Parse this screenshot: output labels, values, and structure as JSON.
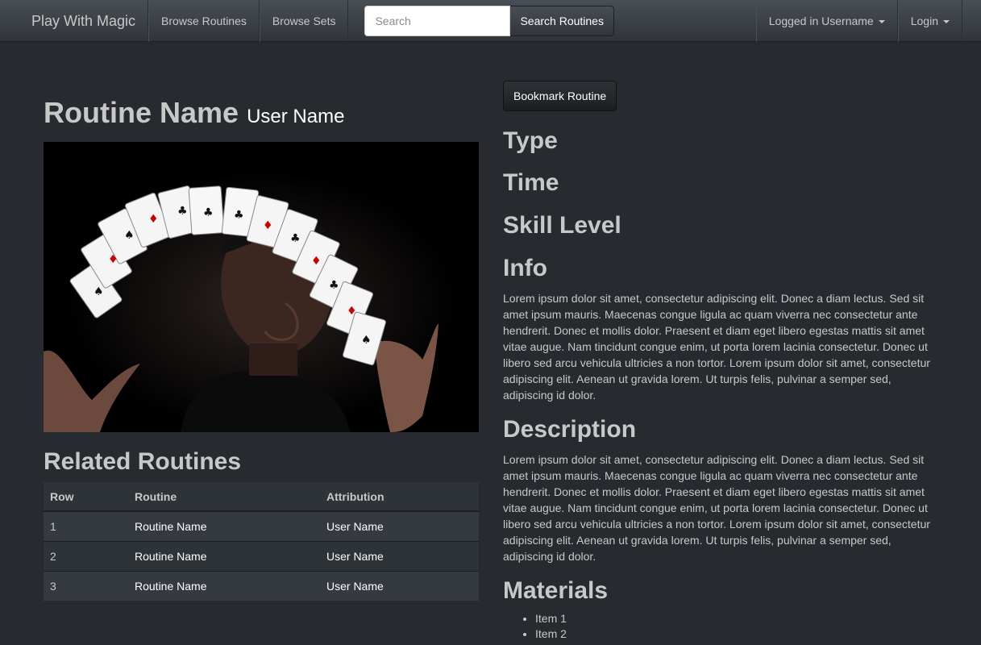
{
  "navbar": {
    "brand": "Play With Magic",
    "links": [
      "Browse Routines",
      "Browse Sets"
    ],
    "search_placeholder": "Search",
    "search_button": "Search Routines",
    "user_menu": "Logged in Username",
    "login_menu": "Login"
  },
  "routine": {
    "name": "Routine Name",
    "author": "User Name",
    "bookmark_label": "Bookmark Routine"
  },
  "related": {
    "title": "Related Routines",
    "headers": [
      "Row",
      "Routine",
      "Attribution"
    ],
    "rows": [
      [
        "1",
        "Routine Name",
        "User Name"
      ],
      [
        "2",
        "Routine Name",
        "User Name"
      ],
      [
        "3",
        "Routine Name",
        "User Name"
      ]
    ]
  },
  "details": {
    "type_heading": "Type",
    "time_heading": "Time",
    "skill_heading": "Skill Level",
    "info_heading": "Info",
    "info_text": "Lorem ipsum dolor sit amet, consectetur adipiscing elit. Donec a diam lectus. Sed sit amet ipsum mauris. Maecenas congue ligula ac quam viverra nec consectetur ante hendrerit. Donec et mollis dolor. Praesent et diam eget libero egestas mattis sit amet vitae augue. Nam tincidunt congue enim, ut porta lorem lacinia consectetur. Donec ut libero sed arcu vehicula ultricies a non tortor. Lorem ipsum dolor sit amet, consectetur adipiscing elit. Aenean ut gravida lorem. Ut turpis felis, pulvinar a semper sed, adipiscing id dolor.",
    "description_heading": "Description",
    "description_text": "Lorem ipsum dolor sit amet, consectetur adipiscing elit. Donec a diam lectus. Sed sit amet ipsum mauris. Maecenas congue ligula ac quam viverra nec consectetur ante hendrerit. Donec et mollis dolor. Praesent et diam eget libero egestas mattis sit amet vitae augue. Nam tincidunt congue enim, ut porta lorem lacinia consectetur. Donec ut libero sed arcu vehicula ultricies a non tortor. Lorem ipsum dolor sit amet, consectetur adipiscing elit. Aenean ut gravida lorem. Ut turpis felis, pulvinar a semper sed, adipiscing id dolor.",
    "materials_heading": "Materials",
    "materials": [
      "Item 1",
      "Item 2"
    ]
  },
  "image": {
    "subject": "magician-card-fan-photo"
  },
  "colors": {
    "background": "#272b30",
    "navbar": "#3a3f44",
    "text": "#c8c8c8",
    "heading": "#c8c8c8"
  }
}
